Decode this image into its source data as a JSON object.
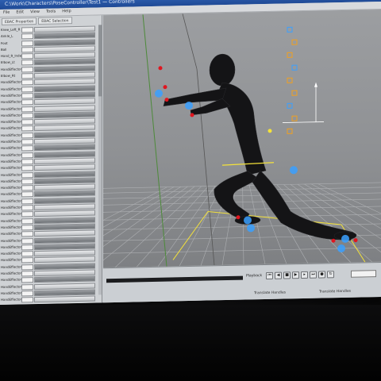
{
  "window": {
    "title": "C:\\Work\\Characters\\PoseController\\Test1 — Controllers"
  },
  "menu": [
    "File",
    "Edit",
    "View",
    "Tools",
    "Help"
  ],
  "panel": {
    "tabs": [
      "EBAC Properties",
      "EBAC Selection"
    ],
    "rows": [
      {
        "label": "Knee_Left_R",
        "dark": false
      },
      {
        "label": "Ankle_L",
        "dark": true
      },
      {
        "label": "Foot",
        "dark": true
      },
      {
        "label": "Ball",
        "dark": false
      },
      {
        "label": "Hand_R_Index",
        "dark": false
      },
      {
        "label": "Elbow_Lt",
        "dark": true
      },
      {
        "label": "HandEffector_L",
        "dark": true
      },
      {
        "label": "Elbow_Rt",
        "dark": false
      },
      {
        "label": "HandEffector_Rt",
        "dark": false
      },
      {
        "label": "HandEffector_Mid",
        "dark": true
      },
      {
        "label": "HandEffector_Arm",
        "dark": true
      },
      {
        "label": "HandEffector_Leg",
        "dark": false
      },
      {
        "label": "HandEffector_Hip",
        "dark": false
      },
      {
        "label": "HandEffector_Spine",
        "dark": true
      },
      {
        "label": "HandEffector_Neck",
        "dark": false
      },
      {
        "label": "HandEffector_Head",
        "dark": false
      },
      {
        "label": "HandEffector_Jnt",
        "dark": true
      },
      {
        "label": "HandEffector_Roll",
        "dark": false
      },
      {
        "label": "HandEffector_Hand",
        "dark": true
      },
      {
        "label": "HandEffector_Toe",
        "dark": true
      },
      {
        "label": "HandEffector_Heel",
        "dark": false
      },
      {
        "label": "HandEffector_Pole",
        "dark": false
      },
      {
        "label": "HandEffector_Knee",
        "dark": true
      },
      {
        "label": "HandEffector_Ball",
        "dark": true
      },
      {
        "label": "HandEffector_Tip",
        "dark": false
      },
      {
        "label": "HandEffector_Aim",
        "dark": true
      },
      {
        "label": "HandEffector_Up",
        "dark": true
      },
      {
        "label": "HandEffector_Side",
        "dark": false
      },
      {
        "label": "HandEffector_Base",
        "dark": false
      },
      {
        "label": "HandEffector_Root",
        "dark": true
      },
      {
        "label": "HandEffector_Pelvis",
        "dark": true
      },
      {
        "label": "HandEffector_Chest",
        "dark": false
      },
      {
        "label": "HandEffector_Clav",
        "dark": true
      },
      {
        "label": "HandEffector_Wrist",
        "dark": true
      },
      {
        "label": "HandEffector_Finger",
        "dark": false
      },
      {
        "label": "HandEffector_Thumb",
        "dark": false
      },
      {
        "label": "HandEffector_Shldr",
        "dark": true
      },
      {
        "label": "HandEffector_Jaw",
        "dark": false
      },
      {
        "label": "HandEffector_Eye",
        "dark": true
      },
      {
        "label": "HandEffector_Hair",
        "dark": false
      },
      {
        "label": "HandEffector_Tail",
        "dark": true
      },
      {
        "label": "HandEffector_Extra",
        "dark": false
      }
    ]
  },
  "timeline": {
    "playback_label": "Playback",
    "frame_value": "",
    "handles_label": "Translate Handles",
    "handles_label2": "Translate Handles"
  },
  "colors": {
    "titlebar": "#1f4a96",
    "viewport_bg": "#9c9ea1",
    "grid": "#a4a6a9",
    "accent_yellow": "#f4e23a",
    "effector_red": "#e0161f",
    "effector_blue": "#3aa0ff",
    "marker_orange": "#f0a020"
  }
}
